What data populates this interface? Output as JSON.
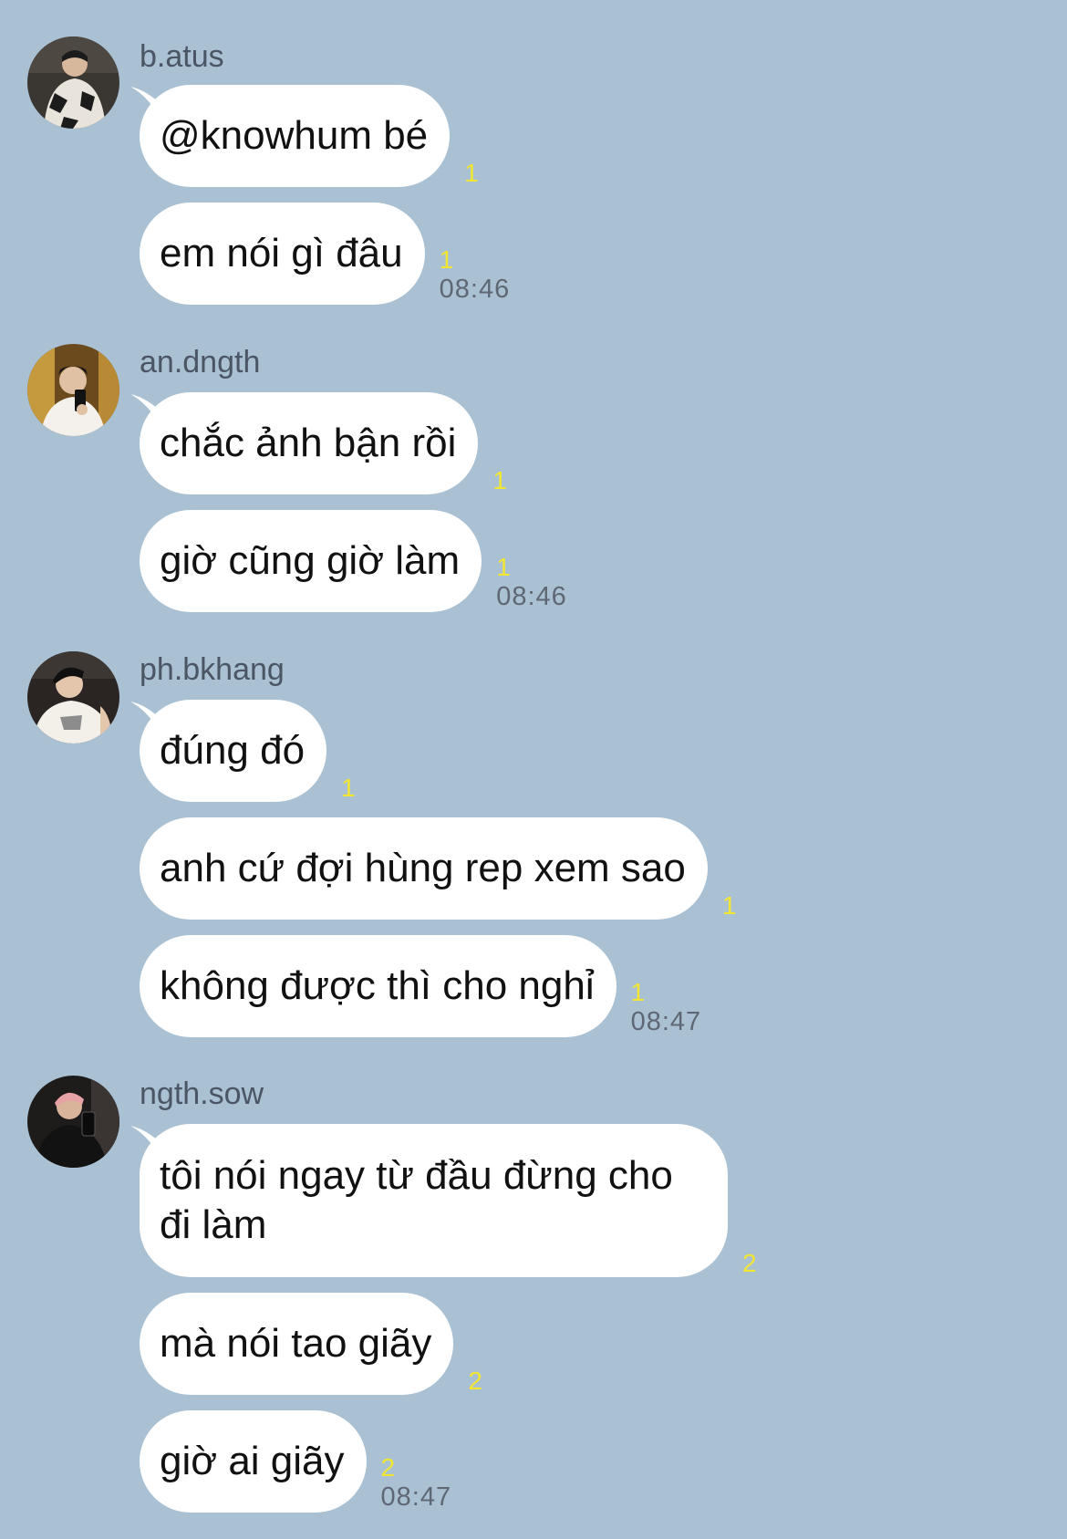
{
  "chat": {
    "groups": [
      {
        "sender": "b.atus",
        "avatar_icon": "user-avatar-photo",
        "messages": [
          {
            "text": "@knowhum bé",
            "read": "1",
            "time": ""
          },
          {
            "text": "em nói gì đâu",
            "read": "1",
            "time": "08:46"
          }
        ]
      },
      {
        "sender": "an.dngth",
        "avatar_icon": "user-avatar-photo",
        "messages": [
          {
            "text": "chắc ảnh bận rồi",
            "read": "1",
            "time": ""
          },
          {
            "text": "giờ cũng giờ làm",
            "read": "1",
            "time": "08:46"
          }
        ]
      },
      {
        "sender": "ph.bkhang",
        "avatar_icon": "user-avatar-photo",
        "messages": [
          {
            "text": "đúng đó",
            "read": "1",
            "time": ""
          },
          {
            "text": "anh cứ đợi hùng rep xem sao",
            "read": "1",
            "time": ""
          },
          {
            "text": "không được thì cho nghỉ",
            "read": "1",
            "time": "08:47"
          }
        ]
      },
      {
        "sender": "ngth.sow",
        "avatar_icon": "user-avatar-photo",
        "messages": [
          {
            "text": "tôi nói ngay từ đầu đừng cho đi làm",
            "read": "2",
            "time": ""
          },
          {
            "text": "mà nói tao giãy",
            "read": "2",
            "time": ""
          },
          {
            "text": "giờ ai giãy",
            "read": "2",
            "time": "08:47"
          }
        ]
      }
    ]
  },
  "colors": {
    "background": "#AAC0D3",
    "bubble": "#FFFFFF",
    "read_count": "#F2E632",
    "timestamp": "#5E6875",
    "sender_name": "#4A5666"
  }
}
